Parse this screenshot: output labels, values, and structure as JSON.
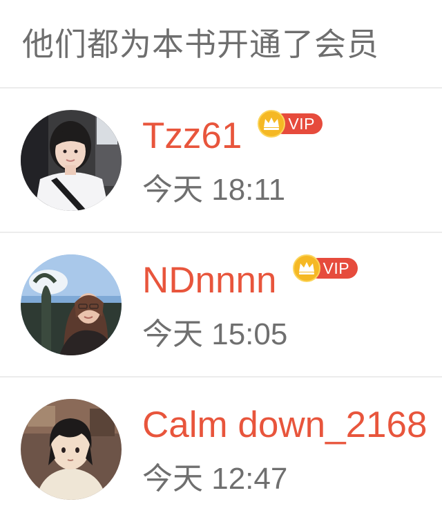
{
  "header": {
    "title": "他们都为本书开通了会员"
  },
  "members": [
    {
      "name": "Tzz61",
      "time": "今天 18:11",
      "badge": "VIP",
      "avatar_icon": "avatar-girl-in-car"
    },
    {
      "name": "NDnnnn",
      "time": "今天 15:05",
      "badge": "VIP",
      "avatar_icon": "avatar-girl-outdoors"
    },
    {
      "name": "Calm down_2168",
      "time": "今天 12:47",
      "badge": "",
      "avatar_icon": "avatar-anime-boy"
    }
  ],
  "colors": {
    "name": "#e8553c",
    "vip_badge": "#e64b3c",
    "crown": "#f5b824",
    "secondary_text": "#6f6f6f",
    "divider": "#ececec"
  }
}
